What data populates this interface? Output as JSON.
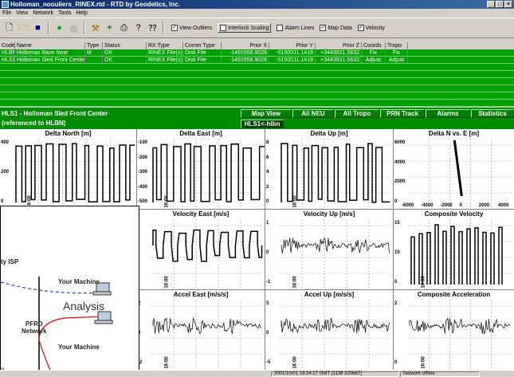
{
  "window": {
    "title": "Holloman_noouliers_RINEX.rtd - RTD by Geodetics, Inc."
  },
  "menu": [
    "File",
    "View",
    "Network",
    "Tools",
    "Help"
  ],
  "toolbar": {
    "checks": [
      {
        "label": "View Outliers",
        "checked": true
      },
      {
        "label": "Interlock Scaling",
        "checked": false
      },
      {
        "label": "Alarm Lines",
        "checked": false
      },
      {
        "label": "Map Data",
        "checked": true
      },
      {
        "label": "Velocity",
        "checked": true
      }
    ]
  },
  "table": {
    "headers": [
      "Code",
      "Name",
      "Type",
      "Status",
      "RX Type",
      "Comm Type",
      "Prior X",
      "Prior Y",
      "Prior Z",
      "Coords",
      "Tropo"
    ],
    "rows": [
      [
        "HLBN",
        "Holloman Base Near",
        "M",
        "OK",
        "RINEX File(s)",
        "Disk File",
        "-1491556.9026",
        "-5150011.1418",
        "+3443921.5632",
        "Fix",
        "Fix"
      ],
      [
        "HLS1",
        "Holloman Sled Front Center",
        "",
        "OK",
        "RINEX File(s)",
        "Disk File",
        "-1491556.9026",
        "-5150011.1418",
        "+3443921.5632",
        "Adjust",
        "Adjust"
      ]
    ]
  },
  "station": {
    "line1": "HLS1 - Holloman Sled Front Center",
    "line2": "(referenced to HLBN)"
  },
  "panel_buttons": [
    "Map View",
    "All NEU",
    "All Tropo",
    "PRN Track",
    "Alarms",
    "Statistics"
  ],
  "sub_button": "HLS1<-hlbn",
  "plots": {
    "r1": [
      {
        "title": "Delta North [m]",
        "ticks": [
          "400",
          "200",
          "0"
        ]
      },
      {
        "title": "Delta East [m]",
        "ticks": [
          "-100",
          "-200",
          "-300",
          "-400",
          "-500"
        ]
      },
      {
        "title": "Delta Up [m]",
        "ticks": [
          "8",
          "6",
          "4",
          "2",
          "0"
        ]
      },
      {
        "title": "Delta N vs. E [m]",
        "ticks": [
          "6000",
          "4000",
          "2000",
          "0"
        ],
        "xticks": [
          "-6000",
          "-4000",
          "-2000",
          "0",
          "2000",
          "4000"
        ]
      }
    ],
    "r2": [
      {
        "title": "Velocity North [m/s]",
        "ticks": []
      },
      {
        "title": "Velocity East [m/s]",
        "ticks": []
      },
      {
        "title": "Velocity Up [m/s]",
        "ticks": [
          "1",
          "0",
          "-1"
        ]
      },
      {
        "title": "Composite Velocity",
        "ticks": [
          "15",
          "10",
          "5"
        ]
      }
    ],
    "r3": [
      {
        "title": "Accel North [m/s/s]",
        "ticks": []
      },
      {
        "title": "Accel East [m/s/s]",
        "ticks": [
          "2",
          "0",
          "-2"
        ]
      },
      {
        "title": "Accel Up [m/s/s]",
        "ticks": [
          "5",
          "0",
          "-5"
        ]
      },
      {
        "title": "Composite Acceleration",
        "ticks": [
          "2",
          "0"
        ]
      }
    ],
    "time_tick": "16:00"
  },
  "status": {
    "time": "2001/10/01 19:24:27 GMT (1138 320667)",
    "network": "Network offline"
  },
  "overlay": {
    "isp": "ty ISP",
    "machine1": "Your Machine",
    "analysis": "Analysis",
    "network": "PFRD\nNetwork",
    "machine2": "Your Machine",
    "tail": "n"
  },
  "colors": {
    "grid_green": "#00a000",
    "trace": "#000000",
    "title_blue": "#0a246a"
  }
}
